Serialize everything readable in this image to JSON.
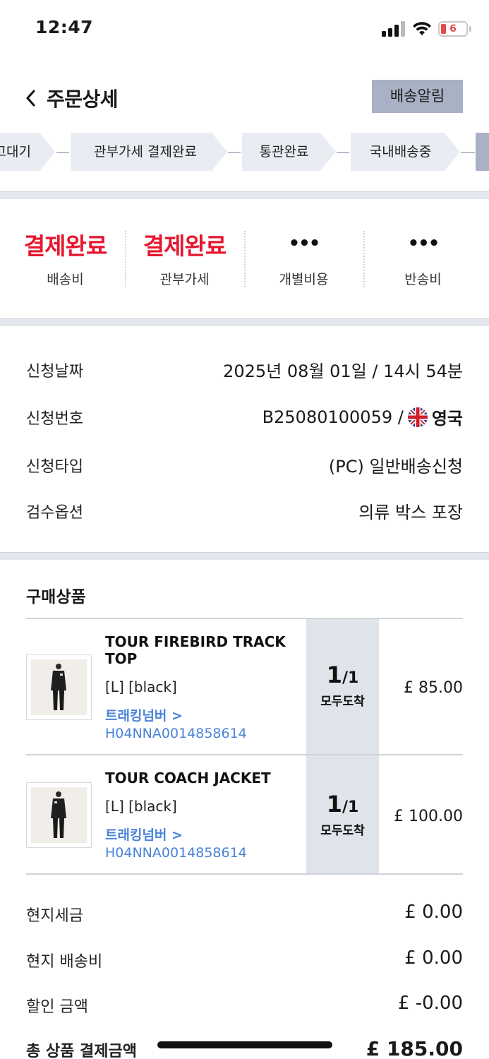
{
  "status_bar": {
    "time": "12:47",
    "battery": "6",
    "battery_color": "#e5484d"
  },
  "header": {
    "title": "주문상세",
    "notify_button": "배송알림"
  },
  "steps": [
    "입고대기",
    "관부가세 결제완료",
    "통관완료",
    "국내배송중"
  ],
  "costs": [
    {
      "status": "결제완료",
      "label": "배송비"
    },
    {
      "status": "결제완료",
      "label": "관부가세"
    },
    {
      "status": "•••",
      "label": "개별비용"
    },
    {
      "status": "•••",
      "label": "반송비"
    }
  ],
  "info": {
    "date_label": "신청날짜",
    "date_value": "2025년 08월 01일 / 14시 54분",
    "number_label": "신청번호",
    "number_value": "B25080100059 /",
    "country": "영국",
    "flag_icon": "uk-flag-icon",
    "type_label": "신청타입",
    "type_value": "(PC) 일반배송신청",
    "option_label": "검수옵션",
    "option_value": "의류 박스 포장"
  },
  "products": {
    "title": "구매상품",
    "items": [
      {
        "name": "TOUR FIREBIRD TRACK TOP",
        "option": "[L] [black]",
        "tracking_label": "트래킹넘버 >",
        "tracking_no": "H04NNA0014858614",
        "qty_num": "1",
        "qty_den": "/1",
        "qty_status": "모두도착",
        "price": "£ 85.00"
      },
      {
        "name": "TOUR COACH JACKET",
        "option": "[L] [black]",
        "tracking_label": "트래킹넘버 >",
        "tracking_no": "H04NNA0014858614",
        "qty_num": "1",
        "qty_den": "/1",
        "qty_status": "모두도착",
        "price": "£ 100.00"
      }
    ]
  },
  "totals": [
    {
      "label": "현지세금",
      "value": "£ 0.00"
    },
    {
      "label": "현지 배송비",
      "value": "£ 0.00"
    },
    {
      "label": "할인 금액",
      "value": "£ -0.00"
    },
    {
      "label": "총 상품 결제금액",
      "value": "£ 185.00"
    }
  ],
  "colors": {
    "accent_red": "#e6162d",
    "link_blue": "#4a83d8",
    "button_gray": "#a9b1c4"
  }
}
